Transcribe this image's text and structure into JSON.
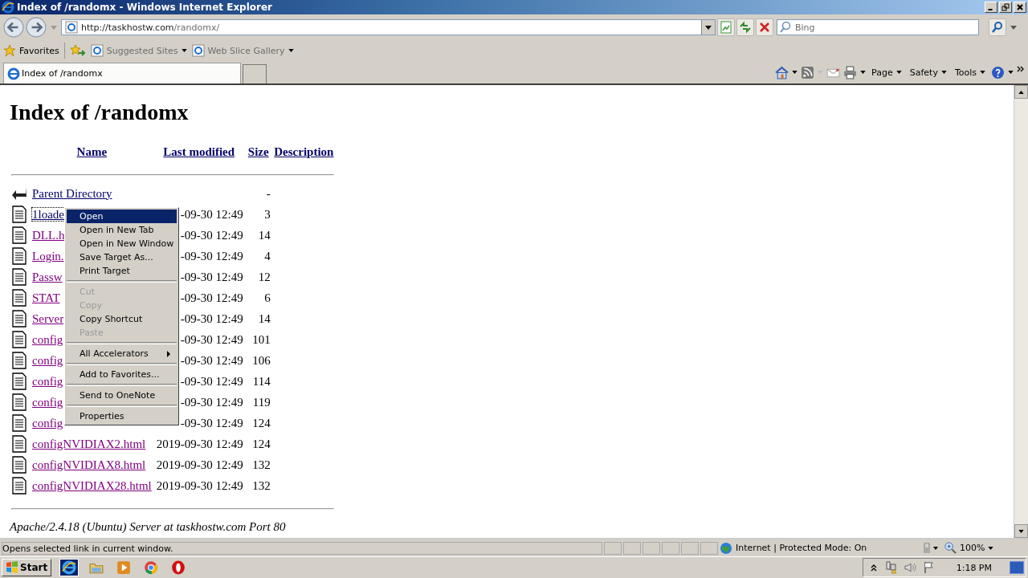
{
  "window": {
    "title": "Index of /randomx - Windows Internet Explorer"
  },
  "address_bar": {
    "url_host": "http://taskhostw.com",
    "url_path": "/randomx/"
  },
  "search": {
    "placeholder": "Bing"
  },
  "favorites_bar": {
    "favorites": "Favorites",
    "items": [
      "Suggested Sites",
      "Web Slice Gallery"
    ]
  },
  "tabs": [
    {
      "label": "Index of /randomx",
      "selected": true
    }
  ],
  "command_bar": [
    "Page",
    "Safety",
    "Tools"
  ],
  "page": {
    "heading": "Index of /randomx",
    "columns": [
      "Name",
      "Last modified",
      "Size",
      "Description"
    ],
    "rows": [
      {
        "kind": "parent",
        "name": "Parent Directory",
        "modified": "",
        "size": "-",
        "visited": false,
        "focused": false
      },
      {
        "kind": "file",
        "name": "1loade",
        "modified": "-09-30 12:49",
        "size": "3",
        "visited": false,
        "focused": true
      },
      {
        "kind": "file",
        "name": "DLL.h",
        "modified": "-09-30 12:49",
        "size": "14",
        "visited": true,
        "focused": false
      },
      {
        "kind": "file",
        "name": "Login.",
        "modified": "-09-30 12:49",
        "size": "4",
        "visited": true,
        "focused": false
      },
      {
        "kind": "file",
        "name": "Passw",
        "modified": "-09-30 12:49",
        "size": "12",
        "visited": true,
        "focused": false
      },
      {
        "kind": "file",
        "name": "STAT",
        "modified": "-09-30 12:49",
        "size": "6",
        "visited": true,
        "focused": false
      },
      {
        "kind": "file",
        "name": "Server",
        "modified": "-09-30 12:49",
        "size": "14",
        "visited": true,
        "focused": false
      },
      {
        "kind": "file",
        "name": "config",
        "modified": "-09-30 12:49",
        "size": "101",
        "visited": true,
        "focused": false
      },
      {
        "kind": "file",
        "name": "config",
        "modified": "-09-30 12:49",
        "size": "106",
        "visited": true,
        "focused": false
      },
      {
        "kind": "file",
        "name": "config",
        "modified": "-09-30 12:49",
        "size": "114",
        "visited": true,
        "focused": false
      },
      {
        "kind": "file",
        "name": "config",
        "modified": "-09-30 12:49",
        "size": "119",
        "visited": true,
        "focused": false
      },
      {
        "kind": "file",
        "name": "config",
        "modified": "-09-30 12:49",
        "size": "124",
        "visited": true,
        "focused": false
      },
      {
        "kind": "file",
        "name": "configNVIDIAX2.html",
        "modified": "2019-09-30 12:49",
        "size": "124",
        "visited": true,
        "focused": false
      },
      {
        "kind": "file",
        "name": "configNVIDIAX8.html",
        "modified": "2019-09-30 12:49",
        "size": "132",
        "visited": true,
        "focused": false
      },
      {
        "kind": "file",
        "name": "configNVIDIAX28.html",
        "modified": "2019-09-30 12:49",
        "size": "132",
        "visited": true,
        "focused": false
      }
    ],
    "footer": "Apache/2.4.18 (Ubuntu) Server at taskhostw.com Port 80"
  },
  "context_menu": [
    {
      "kind": "item",
      "label": "Open",
      "selected": true,
      "disabled": false,
      "submenu": false
    },
    {
      "kind": "item",
      "label": "Open in New Tab",
      "selected": false,
      "disabled": false,
      "submenu": false
    },
    {
      "kind": "item",
      "label": "Open in New Window",
      "selected": false,
      "disabled": false,
      "submenu": false
    },
    {
      "kind": "item",
      "label": "Save Target As...",
      "selected": false,
      "disabled": false,
      "submenu": false
    },
    {
      "kind": "item",
      "label": "Print Target",
      "selected": false,
      "disabled": false,
      "submenu": false
    },
    {
      "kind": "separator"
    },
    {
      "kind": "item",
      "label": "Cut",
      "selected": false,
      "disabled": true,
      "submenu": false
    },
    {
      "kind": "item",
      "label": "Copy",
      "selected": false,
      "disabled": true,
      "submenu": false
    },
    {
      "kind": "item",
      "label": "Copy Shortcut",
      "selected": false,
      "disabled": false,
      "submenu": false
    },
    {
      "kind": "item",
      "label": "Paste",
      "selected": false,
      "disabled": true,
      "submenu": false
    },
    {
      "kind": "separator"
    },
    {
      "kind": "item",
      "label": "All Accelerators",
      "selected": false,
      "disabled": false,
      "submenu": true
    },
    {
      "kind": "separator"
    },
    {
      "kind": "item",
      "label": "Add to Favorites...",
      "selected": false,
      "disabled": false,
      "submenu": false
    },
    {
      "kind": "separator"
    },
    {
      "kind": "item",
      "label": "Send to OneNote",
      "selected": false,
      "disabled": false,
      "submenu": false
    },
    {
      "kind": "separator"
    },
    {
      "kind": "item",
      "label": "Properties",
      "selected": false,
      "disabled": false,
      "submenu": false
    }
  ],
  "status_bar": {
    "message": "Opens selected link in current window.",
    "zone": "Internet | Protected Mode: On",
    "zoom": "100%"
  },
  "taskbar": {
    "start": "Start",
    "clock": "1:18 PM"
  }
}
